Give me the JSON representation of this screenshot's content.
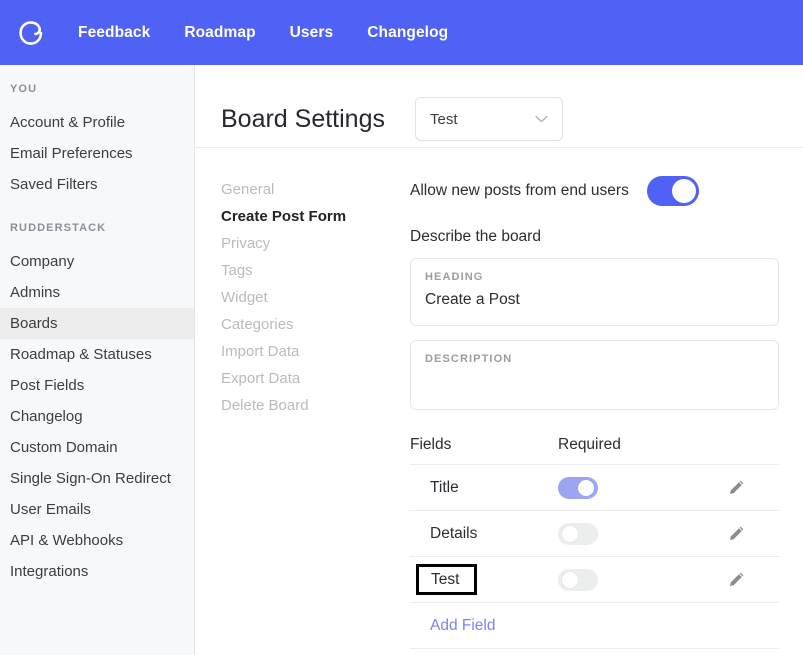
{
  "topbar": {
    "logo_icon": "canny-c-logo-icon",
    "brand_color": "#5061f5",
    "nav": [
      {
        "label": "Feedback"
      },
      {
        "label": "Roadmap"
      },
      {
        "label": "Users"
      },
      {
        "label": "Changelog"
      }
    ]
  },
  "sidebar": {
    "sections": [
      {
        "title": "YOU",
        "items": [
          {
            "label": "Account & Profile",
            "active": false
          },
          {
            "label": "Email Preferences",
            "active": false
          },
          {
            "label": "Saved Filters",
            "active": false
          }
        ]
      },
      {
        "title": "RUDDERSTACK",
        "items": [
          {
            "label": "Company",
            "active": false
          },
          {
            "label": "Admins",
            "active": false
          },
          {
            "label": "Boards",
            "active": true
          },
          {
            "label": "Roadmap & Statuses",
            "active": false
          },
          {
            "label": "Post Fields",
            "active": false
          },
          {
            "label": "Changelog",
            "active": false
          },
          {
            "label": "Custom Domain",
            "active": false
          },
          {
            "label": "Single Sign-On Redirect",
            "active": false
          },
          {
            "label": "User Emails",
            "active": false
          },
          {
            "label": "API & Webhooks",
            "active": false
          },
          {
            "label": "Integrations",
            "active": false
          }
        ]
      }
    ]
  },
  "header": {
    "title": "Board Settings",
    "board_select": {
      "value": "Test",
      "chevron_icon": "chevron-down-icon"
    }
  },
  "subnav": {
    "items": [
      {
        "label": "General",
        "active": false
      },
      {
        "label": "Create Post Form",
        "active": true
      },
      {
        "label": "Privacy",
        "active": false
      },
      {
        "label": "Tags",
        "active": false
      },
      {
        "label": "Widget",
        "active": false
      },
      {
        "label": "Categories",
        "active": false
      },
      {
        "label": "Import Data",
        "active": false
      },
      {
        "label": "Export Data",
        "active": false
      },
      {
        "label": "Delete Board",
        "active": false
      }
    ]
  },
  "form": {
    "allow_posts": {
      "label": "Allow new posts from end users",
      "state": "on",
      "accent_color": "#5061f5"
    },
    "describe_label": "Describe the board",
    "heading_card": {
      "label": "HEADING",
      "value": "Create a Post"
    },
    "description_card": {
      "label": "DESCRIPTION",
      "value": ""
    },
    "fields_table": {
      "columns": [
        "Fields",
        "Required"
      ],
      "rows": [
        {
          "name": "Title",
          "required": "on",
          "toggle_state": "on-disabled",
          "highlighted": false,
          "edit_icon": "pencil-icon"
        },
        {
          "name": "Details",
          "required": "off",
          "toggle_state": "off",
          "highlighted": false,
          "edit_icon": "pencil-icon"
        },
        {
          "name": "Test",
          "required": "off",
          "toggle_state": "off",
          "highlighted": true,
          "edit_icon": "pencil-icon"
        }
      ],
      "add_field_label": "Add Field",
      "add_field_color": "#7b86e8"
    }
  }
}
